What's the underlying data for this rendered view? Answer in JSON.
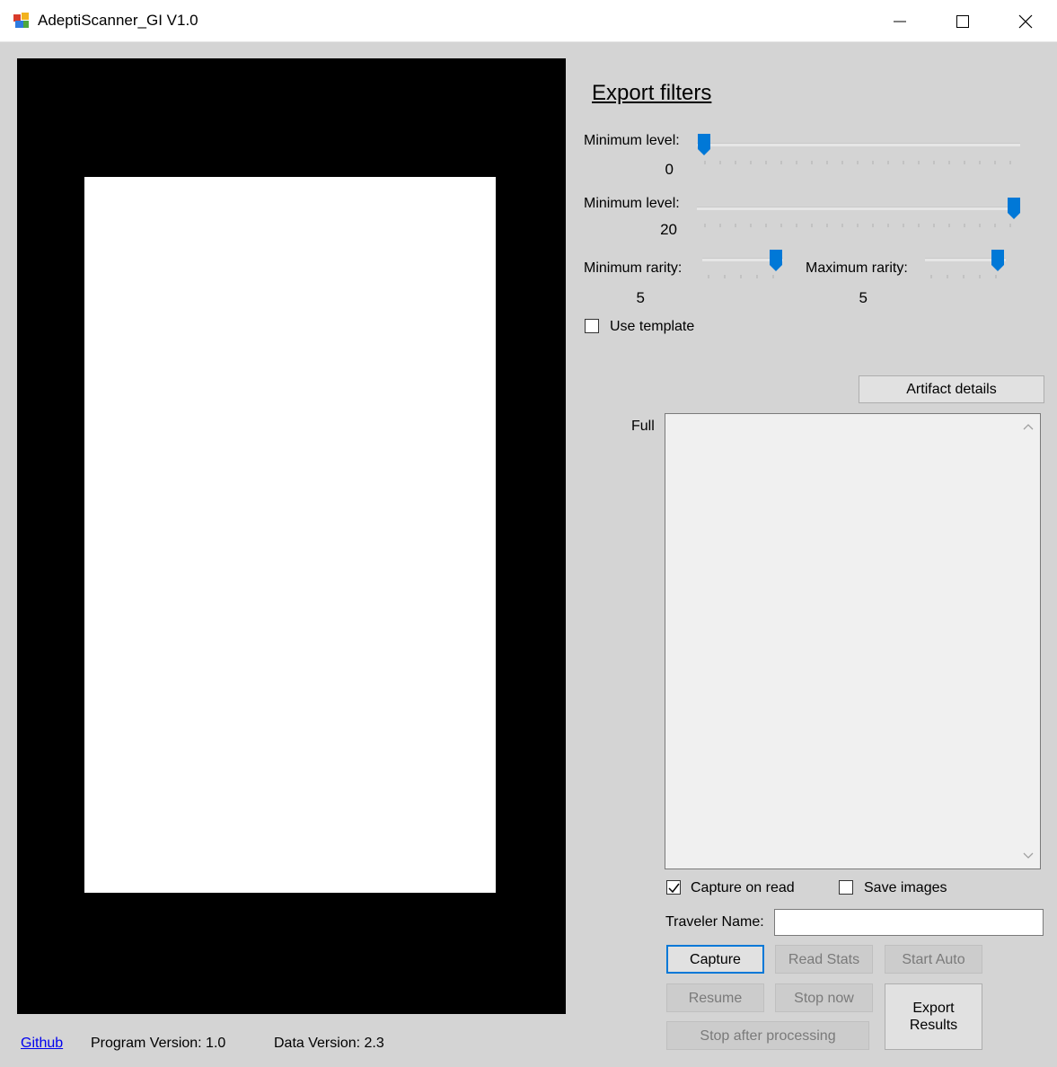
{
  "window": {
    "title": "AdeptiScanner_GI V1.0",
    "controls": [
      "minimize-icon",
      "maximize-icon",
      "close-icon"
    ]
  },
  "filters": {
    "heading": "Export filters",
    "min_level": {
      "label": "Minimum level:",
      "value": "0",
      "level": 0.0
    },
    "max_level": {
      "label": "Minimum level:",
      "value": "20",
      "level": 1.0
    },
    "min_rarity": {
      "label": "Minimum rarity:",
      "value": "5",
      "level": 1.0
    },
    "max_rarity": {
      "label": "Maximum rarity:",
      "value": "5",
      "level": 1.0
    },
    "use_template": {
      "label": "Use template",
      "checked": false
    }
  },
  "details": {
    "button": "Artifact details",
    "mode_label": "Full",
    "text": ""
  },
  "options": {
    "capture_on_read": {
      "label": "Capture on read",
      "checked": true
    },
    "save_images": {
      "label": "Save images",
      "checked": false
    },
    "traveler_label": "Traveler Name:",
    "traveler_value": ""
  },
  "actions": {
    "capture": "Capture",
    "read_stats": "Read Stats",
    "start_auto": "Start Auto",
    "resume": "Resume",
    "stop_now": "Stop now",
    "export_results": "Export Results",
    "stop_after": "Stop after processing"
  },
  "footer": {
    "github": "Github",
    "program_version": "Program Version: 1.0",
    "data_version": "Data Version: 2.3"
  },
  "colors": {
    "slider_thumb": "#0078d7",
    "background": "#d4d4d4",
    "link": "#0000ee"
  }
}
